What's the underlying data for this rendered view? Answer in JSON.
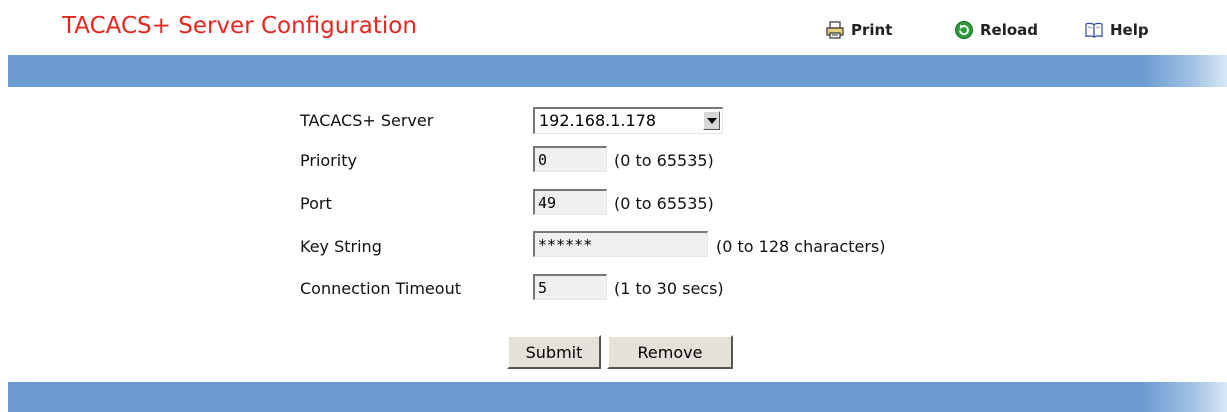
{
  "header": {
    "title": "TACACS+ Server Configuration",
    "toolbar": {
      "print_label": "Print",
      "reload_label": "Reload",
      "help_label": "Help"
    }
  },
  "icons": {
    "print": "printer-icon",
    "reload": "reload-icon",
    "help": "help-book-icon"
  },
  "colors": {
    "title": "#e8251f",
    "band": "#6b9bd1"
  },
  "form": {
    "server": {
      "label": "TACACS+ Server",
      "selected": "192.168.1.178"
    },
    "priority": {
      "label": "Priority",
      "value": "0",
      "hint": "(0 to 65535)"
    },
    "port": {
      "label": "Port",
      "value": "49",
      "hint": "(0 to 65535)"
    },
    "key_string": {
      "label": "Key String",
      "value": "******",
      "hint": "(0 to 128 characters)"
    },
    "timeout": {
      "label": "Connection Timeout",
      "value": "5",
      "hint": "(1 to 30 secs)"
    }
  },
  "buttons": {
    "submit": "Submit",
    "remove": "Remove"
  }
}
